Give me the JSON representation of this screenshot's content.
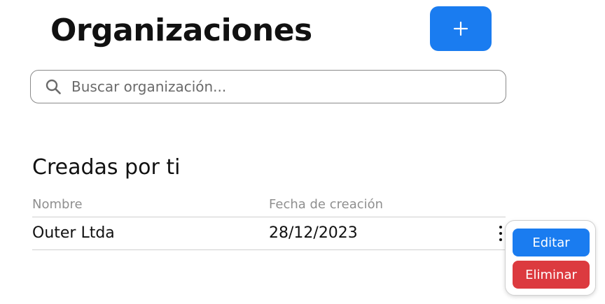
{
  "header": {
    "title": "Organizaciones",
    "add_button_label": "+"
  },
  "search": {
    "placeholder": "Buscar organización...",
    "value": ""
  },
  "sections": [
    {
      "title": "Creadas por ti",
      "columns": [
        "Nombre",
        "Fecha de creación"
      ],
      "rows": [
        {
          "name": "Outer Ltda",
          "created": "28/12/2023"
        }
      ]
    }
  ],
  "context_menu": {
    "edit_label": "Editar",
    "delete_label": "Eliminar"
  },
  "colors": {
    "primary": "#1a7cf0",
    "danger": "#dc3a3f",
    "muted_text": "#8f8f8f",
    "border": "#cfcfcf"
  },
  "icons": {
    "search": "search-icon",
    "add": "plus-icon",
    "row_menu": "more-vertical-icon"
  }
}
